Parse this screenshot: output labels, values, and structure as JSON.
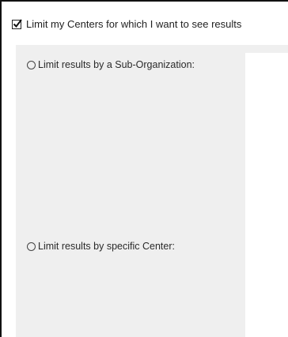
{
  "limit_centers": {
    "checked": true,
    "label": "Limit my Centers for which I want to see results"
  },
  "options": {
    "sub_organization": {
      "label": "Limit results by a Sub-Organization:",
      "selected": false
    },
    "specific_center": {
      "label": "Limit results by specific Center:",
      "selected": false
    }
  },
  "colors": {
    "panel_background": "#efefef",
    "border": "#111111",
    "text": "#222222"
  }
}
